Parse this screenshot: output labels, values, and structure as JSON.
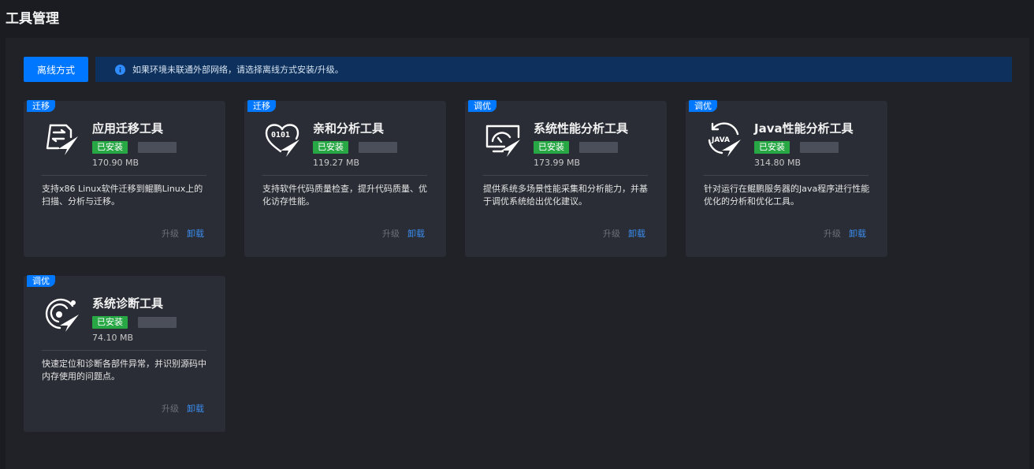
{
  "page": {
    "title": "工具管理"
  },
  "toolbar": {
    "offline_label": "离线方式",
    "notice": "如果环境未联通外部网络，请选择离线方式安装/升级。"
  },
  "colors": {
    "accent": "#0077ff",
    "installed": "#28a745",
    "notice_bg": "#0d315c"
  },
  "tools": [
    {
      "tag": "迁移",
      "name": "应用迁移工具",
      "status": "已安装",
      "size": "170.90 MB",
      "desc": "支持x86 Linux软件迁移到鲲鹏Linux上的扫描、分析与迁移。",
      "upgrade": "升级",
      "uninstall": "卸载",
      "icon": "migration-icon"
    },
    {
      "tag": "迁移",
      "name": "亲和分析工具",
      "status": "已安装",
      "size": "119.27 MB",
      "desc": "支持软件代码质量检查，提升代码质量、优化访存性能。",
      "upgrade": "升级",
      "uninstall": "卸载",
      "icon": "affinity-icon"
    },
    {
      "tag": "调优",
      "name": "系统性能分析工具",
      "status": "已安装",
      "size": "173.99 MB",
      "desc": "提供系统多场景性能采集和分析能力，并基于调优系统给出优化建议。",
      "upgrade": "升级",
      "uninstall": "卸载",
      "icon": "performance-monitor-icon"
    },
    {
      "tag": "调优",
      "name": "Java性能分析工具",
      "status": "已安装",
      "size": "314.80 MB",
      "desc": "针对运行在鲲鹏服务器的Java程序进行性能优化的分析和优化工具。",
      "upgrade": "升级",
      "uninstall": "卸载",
      "icon": "java-icon"
    },
    {
      "tag": "调优",
      "name": "系统诊断工具",
      "status": "已安装",
      "size": "74.10 MB",
      "desc": "快速定位和诊断各部件异常，并识别源码中内存使用的问题点。",
      "upgrade": "升级",
      "uninstall": "卸载",
      "icon": "diagnosis-icon"
    }
  ]
}
